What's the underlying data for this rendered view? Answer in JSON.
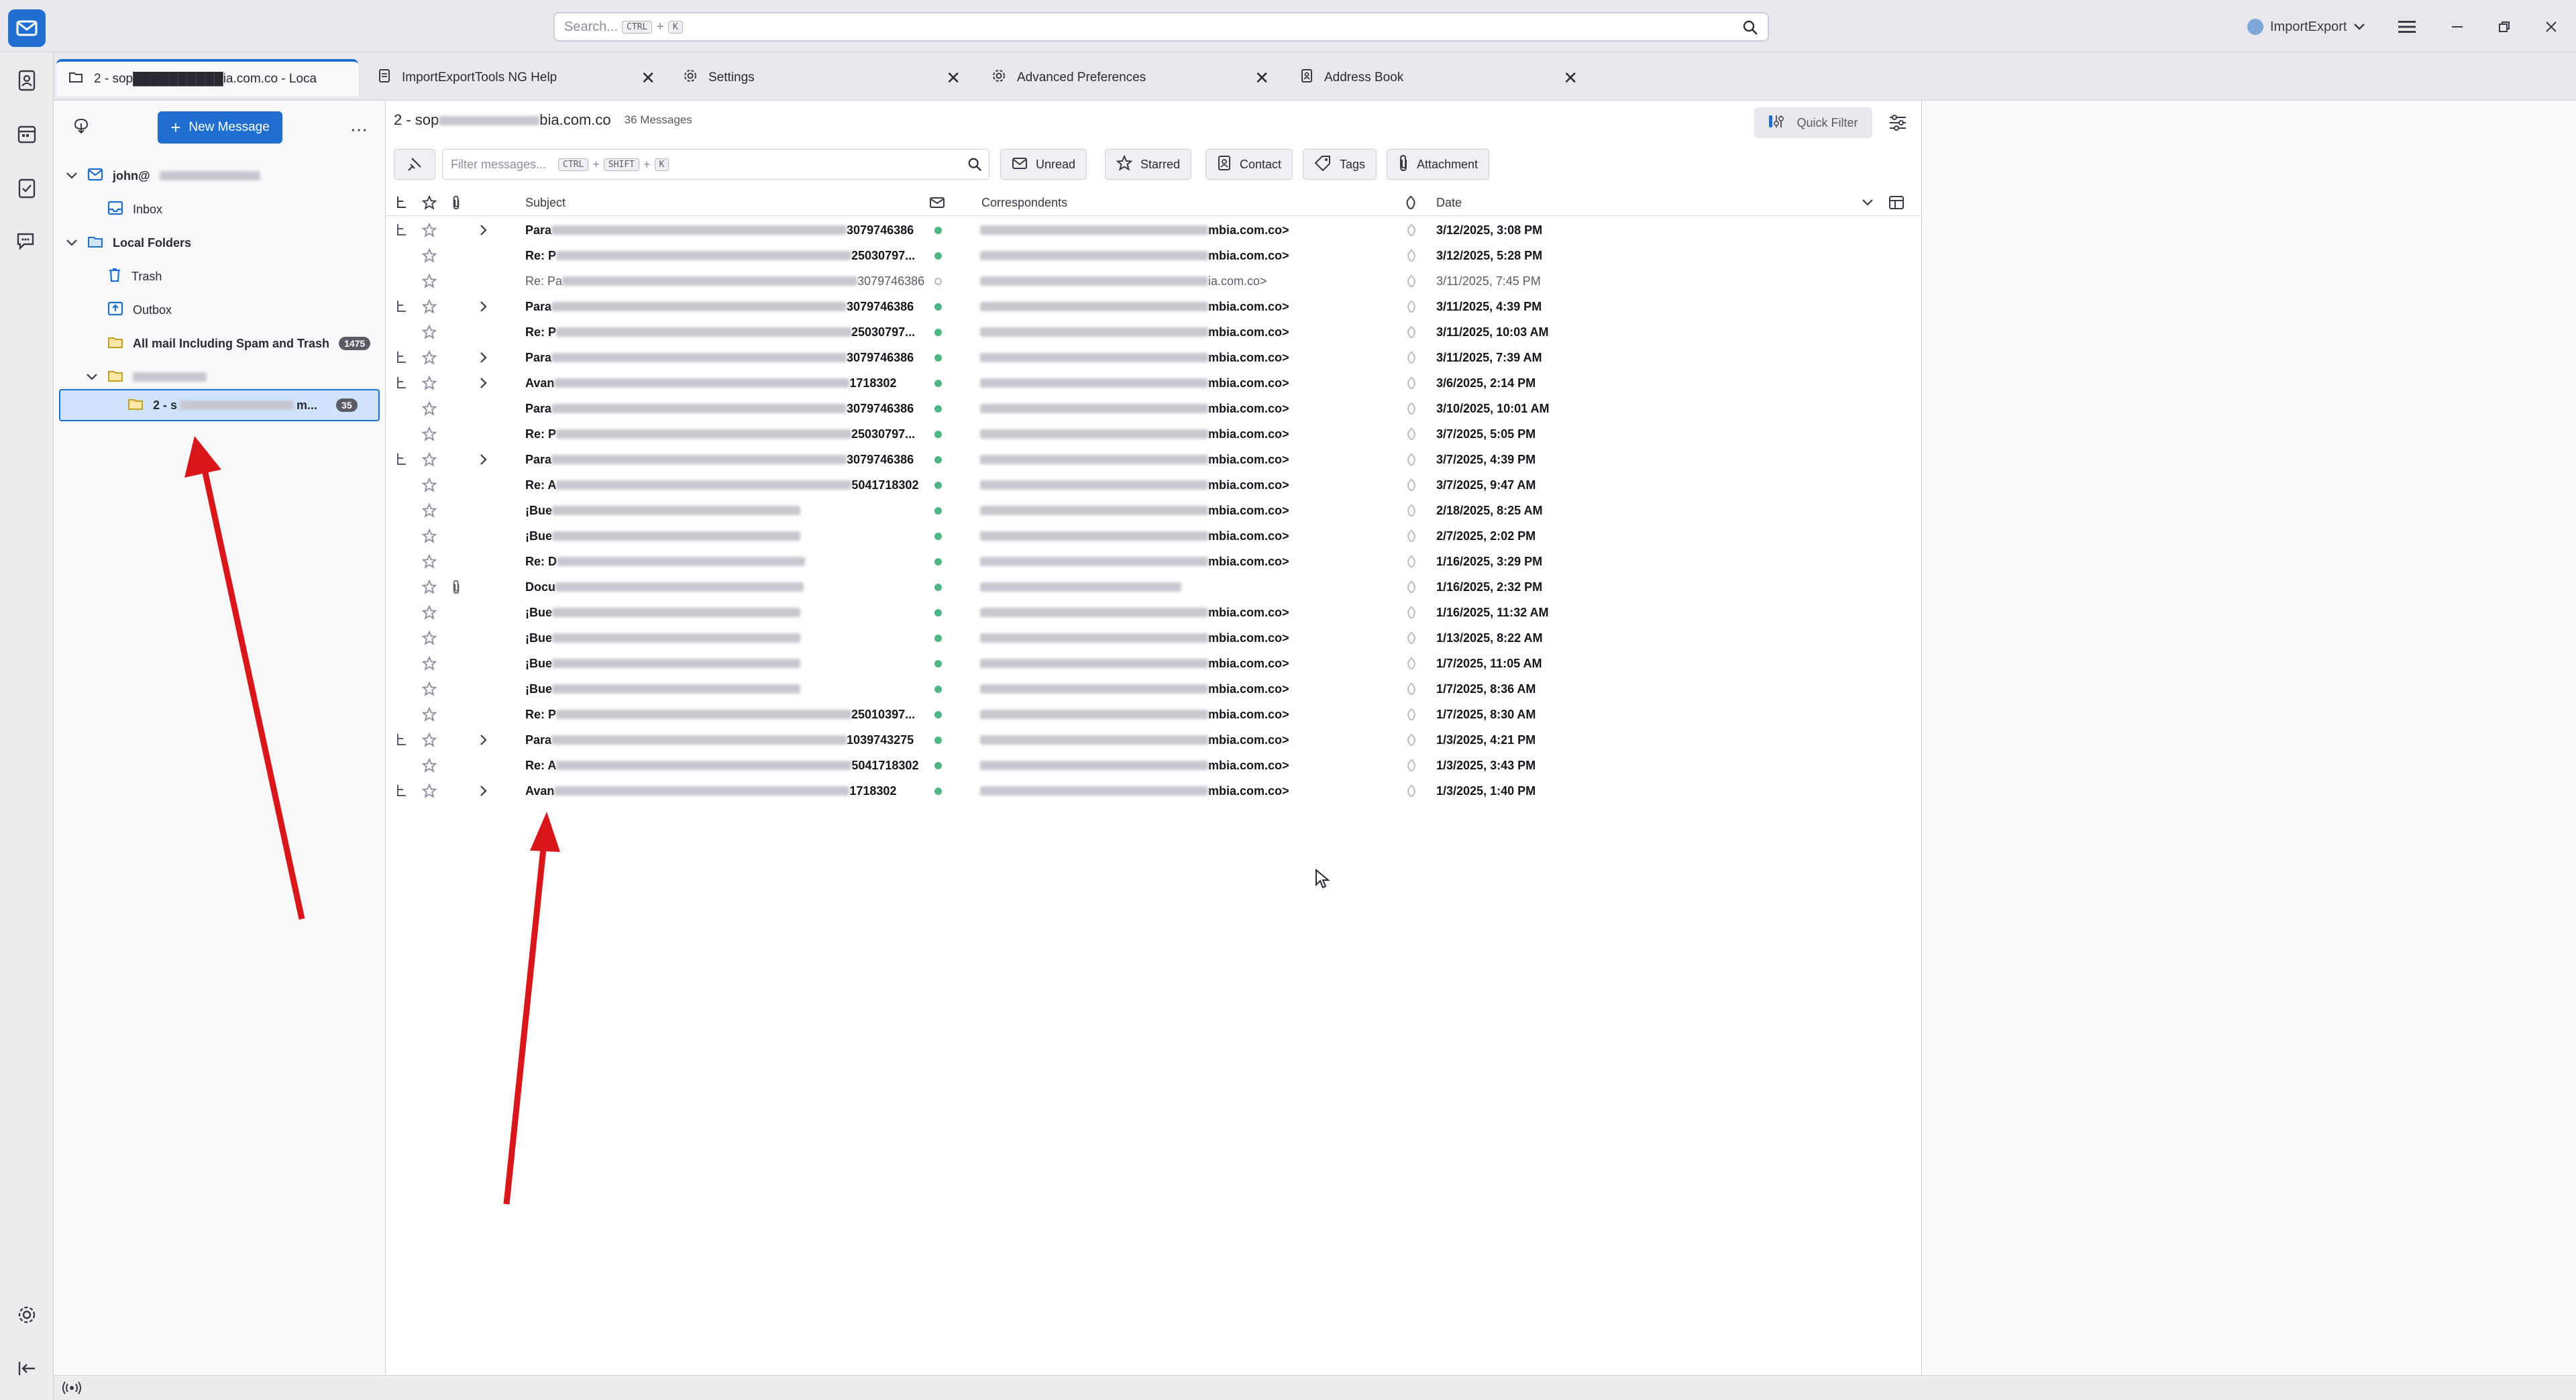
{
  "search": {
    "placeholder": "Search...",
    "shortcut_key1": "CTRL",
    "shortcut_plus": "+",
    "shortcut_key2": "K"
  },
  "account_menu": {
    "label": "ImportExport"
  },
  "tabs": [
    {
      "label": "2 - sop██████████ia.com.co - Loca"
    },
    {
      "label": "ImportExportTools NG Help"
    },
    {
      "label": "Settings"
    },
    {
      "label": "Advanced Preferences"
    },
    {
      "label": "Address Book"
    }
  ],
  "folders": {
    "new_message": "New Message",
    "account": "john@",
    "inbox": "Inbox",
    "local_folders": "Local Folders",
    "trash": "Trash",
    "outbox": "Outbox",
    "all_mail": "All mail Including Spam and Trash",
    "all_mail_count": "1475",
    "selected_folder": "2 - s",
    "selected_folder_suffix": "m...",
    "selected_count": "35"
  },
  "message_list": {
    "folder_title_prefix": "2 - sop",
    "folder_title_suffix": "bia.com.co",
    "count": "36 Messages",
    "quick_filter": "Quick Filter",
    "filter_placeholder": "Filter messages...",
    "filter_key1": "CTRL",
    "filter_key2": "SHIFT",
    "filter_key3": "K",
    "filter_plus": "+",
    "toggles": [
      "Unread",
      "Starred",
      "Contact",
      "Tags",
      "Attachment"
    ],
    "columns": {
      "subject": "Subject",
      "correspondents": "Correspondents",
      "date": "Date"
    },
    "rows": [
      {
        "thread": true,
        "twisty": true,
        "subject_pre": "Para",
        "subject_post": "3079746386",
        "corr": "mbia.com.co>",
        "date": "3/12/2025, 3:08 PM",
        "style": "bold"
      },
      {
        "thread": false,
        "twisty": false,
        "subject_pre": "Re: P",
        "subject_post": "25030797...",
        "corr": "mbia.com.co>",
        "date": "3/12/2025, 5:28 PM",
        "style": "bold"
      },
      {
        "thread": false,
        "twisty": false,
        "subject_pre": "Re: Pa",
        "subject_post": "3079746386",
        "corr": "ia.com.co>",
        "date": "3/11/2025, 7:45 PM",
        "style": "read"
      },
      {
        "thread": true,
        "twisty": true,
        "subject_pre": "Para",
        "subject_post": "3079746386",
        "corr": "mbia.com.co>",
        "date": "3/11/2025, 4:39 PM",
        "style": "bold"
      },
      {
        "thread": false,
        "twisty": false,
        "subject_pre": "Re: P",
        "subject_post": "25030797...",
        "corr": "mbia.com.co>",
        "date": "3/11/2025, 10:03 AM",
        "style": "bold"
      },
      {
        "thread": true,
        "twisty": true,
        "subject_pre": "Para",
        "subject_post": "3079746386",
        "corr": "mbia.com.co>",
        "date": "3/11/2025, 7:39 AM",
        "style": "bold"
      },
      {
        "thread": true,
        "twisty": true,
        "subject_pre": "Avan",
        "subject_post": "1718302",
        "corr": "mbia.com.co>",
        "date": "3/6/2025, 2:14 PM",
        "style": "bold"
      },
      {
        "thread": false,
        "twisty": false,
        "subject_pre": "Para",
        "subject_post": "3079746386",
        "corr": "mbia.com.co>",
        "date": "3/10/2025, 10:01 AM",
        "style": "bold"
      },
      {
        "thread": false,
        "twisty": false,
        "subject_pre": "Re: P",
        "subject_post": "25030797...",
        "corr": "mbia.com.co>",
        "date": "3/7/2025, 5:05 PM",
        "style": "bold"
      },
      {
        "thread": true,
        "twisty": true,
        "subject_pre": "Para",
        "subject_post": "3079746386",
        "corr": "mbia.com.co>",
        "date": "3/7/2025, 4:39 PM",
        "style": "bold"
      },
      {
        "thread": false,
        "twisty": false,
        "subject_pre": "Re: A",
        "subject_post": "5041718302",
        "corr": "mbia.com.co>",
        "date": "3/7/2025, 9:47 AM",
        "style": "bold"
      },
      {
        "thread": false,
        "twisty": false,
        "subject_pre": "¡Bue",
        "subject_post": "",
        "corr": "mbia.com.co>",
        "date": "2/18/2025, 8:25 AM",
        "style": "bold"
      },
      {
        "thread": false,
        "twisty": false,
        "subject_pre": "¡Bue",
        "subject_post": "",
        "corr": "mbia.com.co>",
        "date": "2/7/2025, 2:02 PM",
        "style": "bold"
      },
      {
        "thread": false,
        "twisty": false,
        "subject_pre": "Re: D",
        "subject_post": "",
        "corr": "mbia.com.co>",
        "date": "1/16/2025, 3:29 PM",
        "style": "bold"
      },
      {
        "thread": false,
        "twisty": false,
        "attach": true,
        "subject_pre": "Docu",
        "subject_post": "",
        "corr": "",
        "date": "1/16/2025, 2:32 PM",
        "style": "bold"
      },
      {
        "thread": false,
        "twisty": false,
        "subject_pre": "¡Bue",
        "subject_post": "",
        "corr": "mbia.com.co>",
        "date": "1/16/2025, 11:32 AM",
        "style": "bold"
      },
      {
        "thread": false,
        "twisty": false,
        "subject_pre": "¡Bue",
        "subject_post": "",
        "corr": "mbia.com.co>",
        "date": "1/13/2025, 8:22 AM",
        "style": "bold"
      },
      {
        "thread": false,
        "twisty": false,
        "subject_pre": "¡Bue",
        "subject_post": "",
        "corr": "mbia.com.co>",
        "date": "1/7/2025, 11:05 AM",
        "style": "bold"
      },
      {
        "thread": false,
        "twisty": false,
        "subject_pre": "¡Bue",
        "subject_post": "",
        "corr": "mbia.com.co>",
        "date": "1/7/2025, 8:36 AM",
        "style": "bold"
      },
      {
        "thread": false,
        "twisty": false,
        "subject_pre": "Re: P",
        "subject_post": "25010397...",
        "corr": "mbia.com.co>",
        "date": "1/7/2025, 8:30 AM",
        "style": "bold"
      },
      {
        "thread": true,
        "twisty": true,
        "subject_pre": "Para",
        "subject_post": "1039743275",
        "corr": "mbia.com.co>",
        "date": "1/3/2025, 4:21 PM",
        "style": "bold"
      },
      {
        "thread": false,
        "twisty": false,
        "subject_pre": "Re: A",
        "subject_post": "5041718302",
        "corr": "mbia.com.co>",
        "date": "1/3/2025, 3:43 PM",
        "style": "bold"
      },
      {
        "thread": true,
        "twisty": true,
        "subject_pre": "Avan",
        "subject_post": "1718302",
        "corr": "mbia.com.co>",
        "date": "1/3/2025, 1:40 PM",
        "style": "bold"
      }
    ]
  },
  "colors": {
    "accent": "#1f6fd0",
    "unread_dot": "#4fb783",
    "annotation_arrow": "#d9171a"
  }
}
